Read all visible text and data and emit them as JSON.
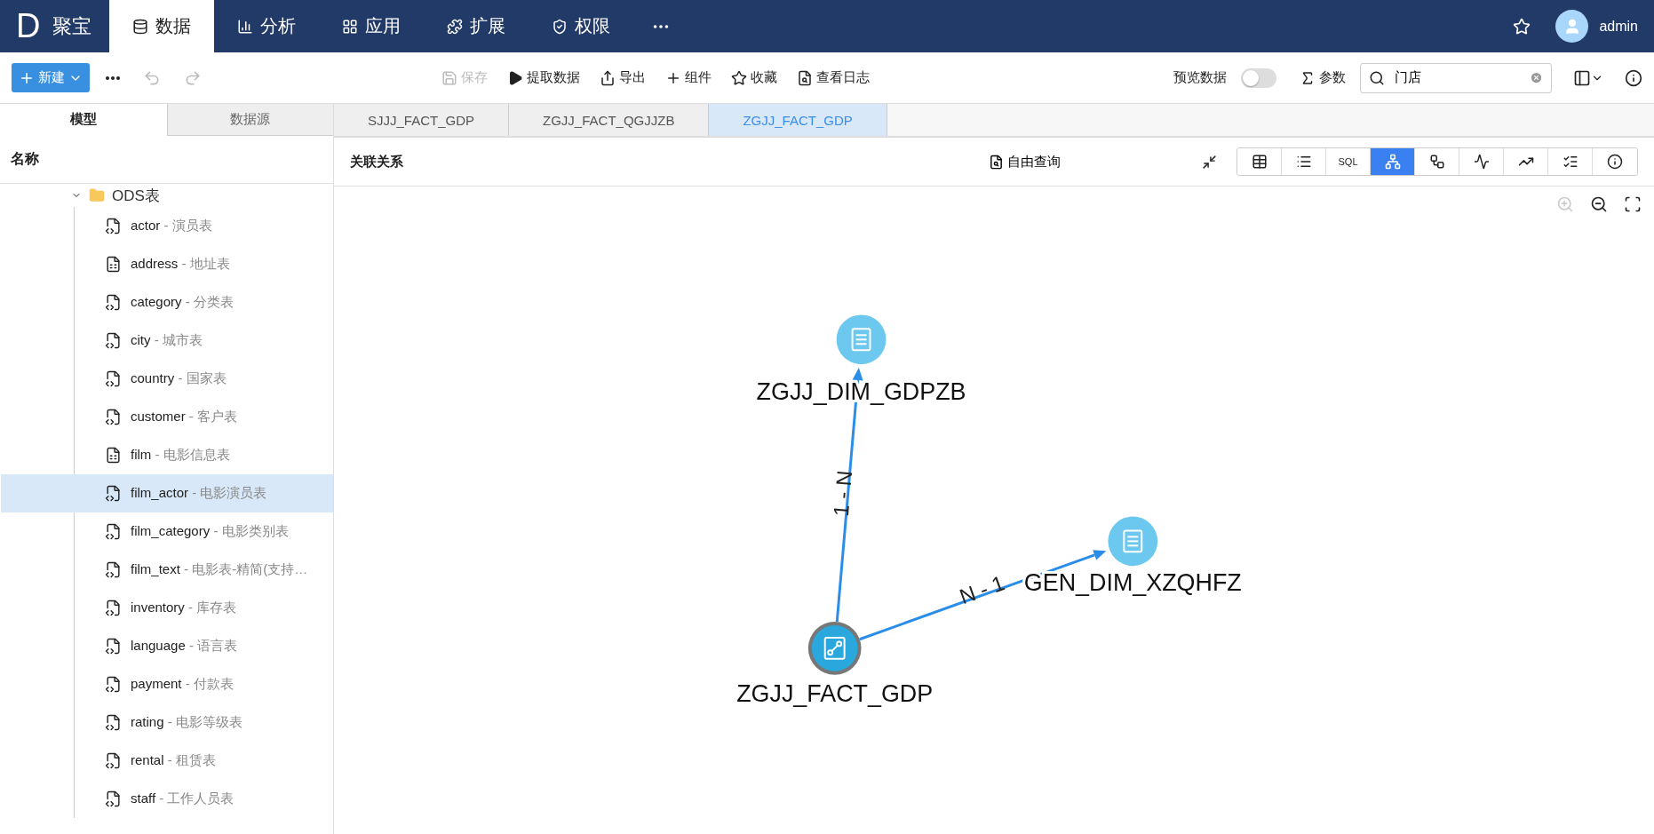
{
  "app": {
    "logo": "D",
    "name": "聚宝"
  },
  "nav": [
    {
      "label": "数据",
      "selected": true
    },
    {
      "label": "分析",
      "selected": false
    },
    {
      "label": "应用",
      "selected": false
    },
    {
      "label": "扩展",
      "selected": false
    },
    {
      "label": "权限",
      "selected": false
    }
  ],
  "user": {
    "name": "admin"
  },
  "toolbar": {
    "new_button": "新建",
    "actions": [
      {
        "label": "保存",
        "disabled": true
      },
      {
        "label": "提取数据",
        "disabled": false
      },
      {
        "label": "导出",
        "disabled": false
      },
      {
        "label": "组件",
        "disabled": false
      },
      {
        "label": "收藏",
        "disabled": false
      },
      {
        "label": "查看日志",
        "disabled": false
      }
    ],
    "preview": {
      "label": "预览数据",
      "on": false
    },
    "params": "参数",
    "search": {
      "value": "门店"
    }
  },
  "sidebar": {
    "tabs": [
      {
        "label": "模型",
        "selected": true
      },
      {
        "label": "数据源",
        "selected": false
      }
    ],
    "header": "名称",
    "tree": [
      {
        "label": "ODS表",
        "expanded": true,
        "children": [
          {
            "name": "actor",
            "desc": "- 演员表",
            "kind": "table",
            "selected": false
          },
          {
            "name": "address",
            "desc": "- 地址表",
            "kind": "join",
            "selected": false
          },
          {
            "name": "category",
            "desc": "- 分类表",
            "kind": "table",
            "selected": false
          },
          {
            "name": "city",
            "desc": "- 城市表",
            "kind": "table",
            "selected": false
          },
          {
            "name": "country",
            "desc": "- 国家表",
            "kind": "table",
            "selected": false
          },
          {
            "name": "customer",
            "desc": "- 客户表",
            "kind": "table",
            "selected": false
          },
          {
            "name": "film",
            "desc": "- 电影信息表",
            "kind": "join",
            "selected": false
          },
          {
            "name": "film_actor",
            "desc": "- 电影演员表",
            "kind": "table",
            "selected": true
          },
          {
            "name": "film_category",
            "desc": "- 电影类别表",
            "kind": "table",
            "selected": false
          },
          {
            "name": "film_text",
            "desc": "- 电影表-精简(支持…",
            "kind": "table",
            "selected": false
          },
          {
            "name": "inventory",
            "desc": "- 库存表",
            "kind": "table",
            "selected": false
          },
          {
            "name": "language",
            "desc": "- 语言表",
            "kind": "table",
            "selected": false
          },
          {
            "name": "payment",
            "desc": "- 付款表",
            "kind": "table",
            "selected": false
          },
          {
            "name": "rating",
            "desc": "- 电影等级表",
            "kind": "table",
            "selected": false
          },
          {
            "name": "rental",
            "desc": "- 租赁表",
            "kind": "table",
            "selected": false
          },
          {
            "name": "staff",
            "desc": "- 工作人员表",
            "kind": "table",
            "selected": false
          }
        ]
      }
    ]
  },
  "doc_tabs": [
    {
      "label": "SJJJ_FACT_GDP",
      "selected": false
    },
    {
      "label": "ZGJJ_FACT_QGJJZB",
      "selected": false
    },
    {
      "label": "ZGJJ_FACT_GDP",
      "selected": true
    }
  ],
  "panel": {
    "title": "关联关系",
    "free_query": "自由查询",
    "views": [
      {
        "kind": "grid",
        "selected": false
      },
      {
        "kind": "list",
        "selected": false
      },
      {
        "kind": "sql",
        "label": "SQL",
        "selected": false
      },
      {
        "kind": "graph",
        "selected": true
      },
      {
        "kind": "tree",
        "selected": false
      },
      {
        "kind": "pulse",
        "selected": false
      },
      {
        "kind": "trend",
        "selected": false
      },
      {
        "kind": "check",
        "selected": false
      },
      {
        "kind": "info",
        "selected": false
      }
    ],
    "zoom_in_disabled": true
  },
  "graph": {
    "nodes": [
      {
        "label": "ZGJJ_DIM_GDPZB",
        "kind": "table",
        "selected": false
      },
      {
        "label": "GEN_DIM_XZQHFZ",
        "kind": "table",
        "selected": false
      },
      {
        "label": "ZGJJ_FACT_GDP",
        "kind": "join",
        "selected": true
      }
    ],
    "edges": [
      {
        "label": "1 - N"
      },
      {
        "label": "N - 1"
      }
    ]
  }
}
